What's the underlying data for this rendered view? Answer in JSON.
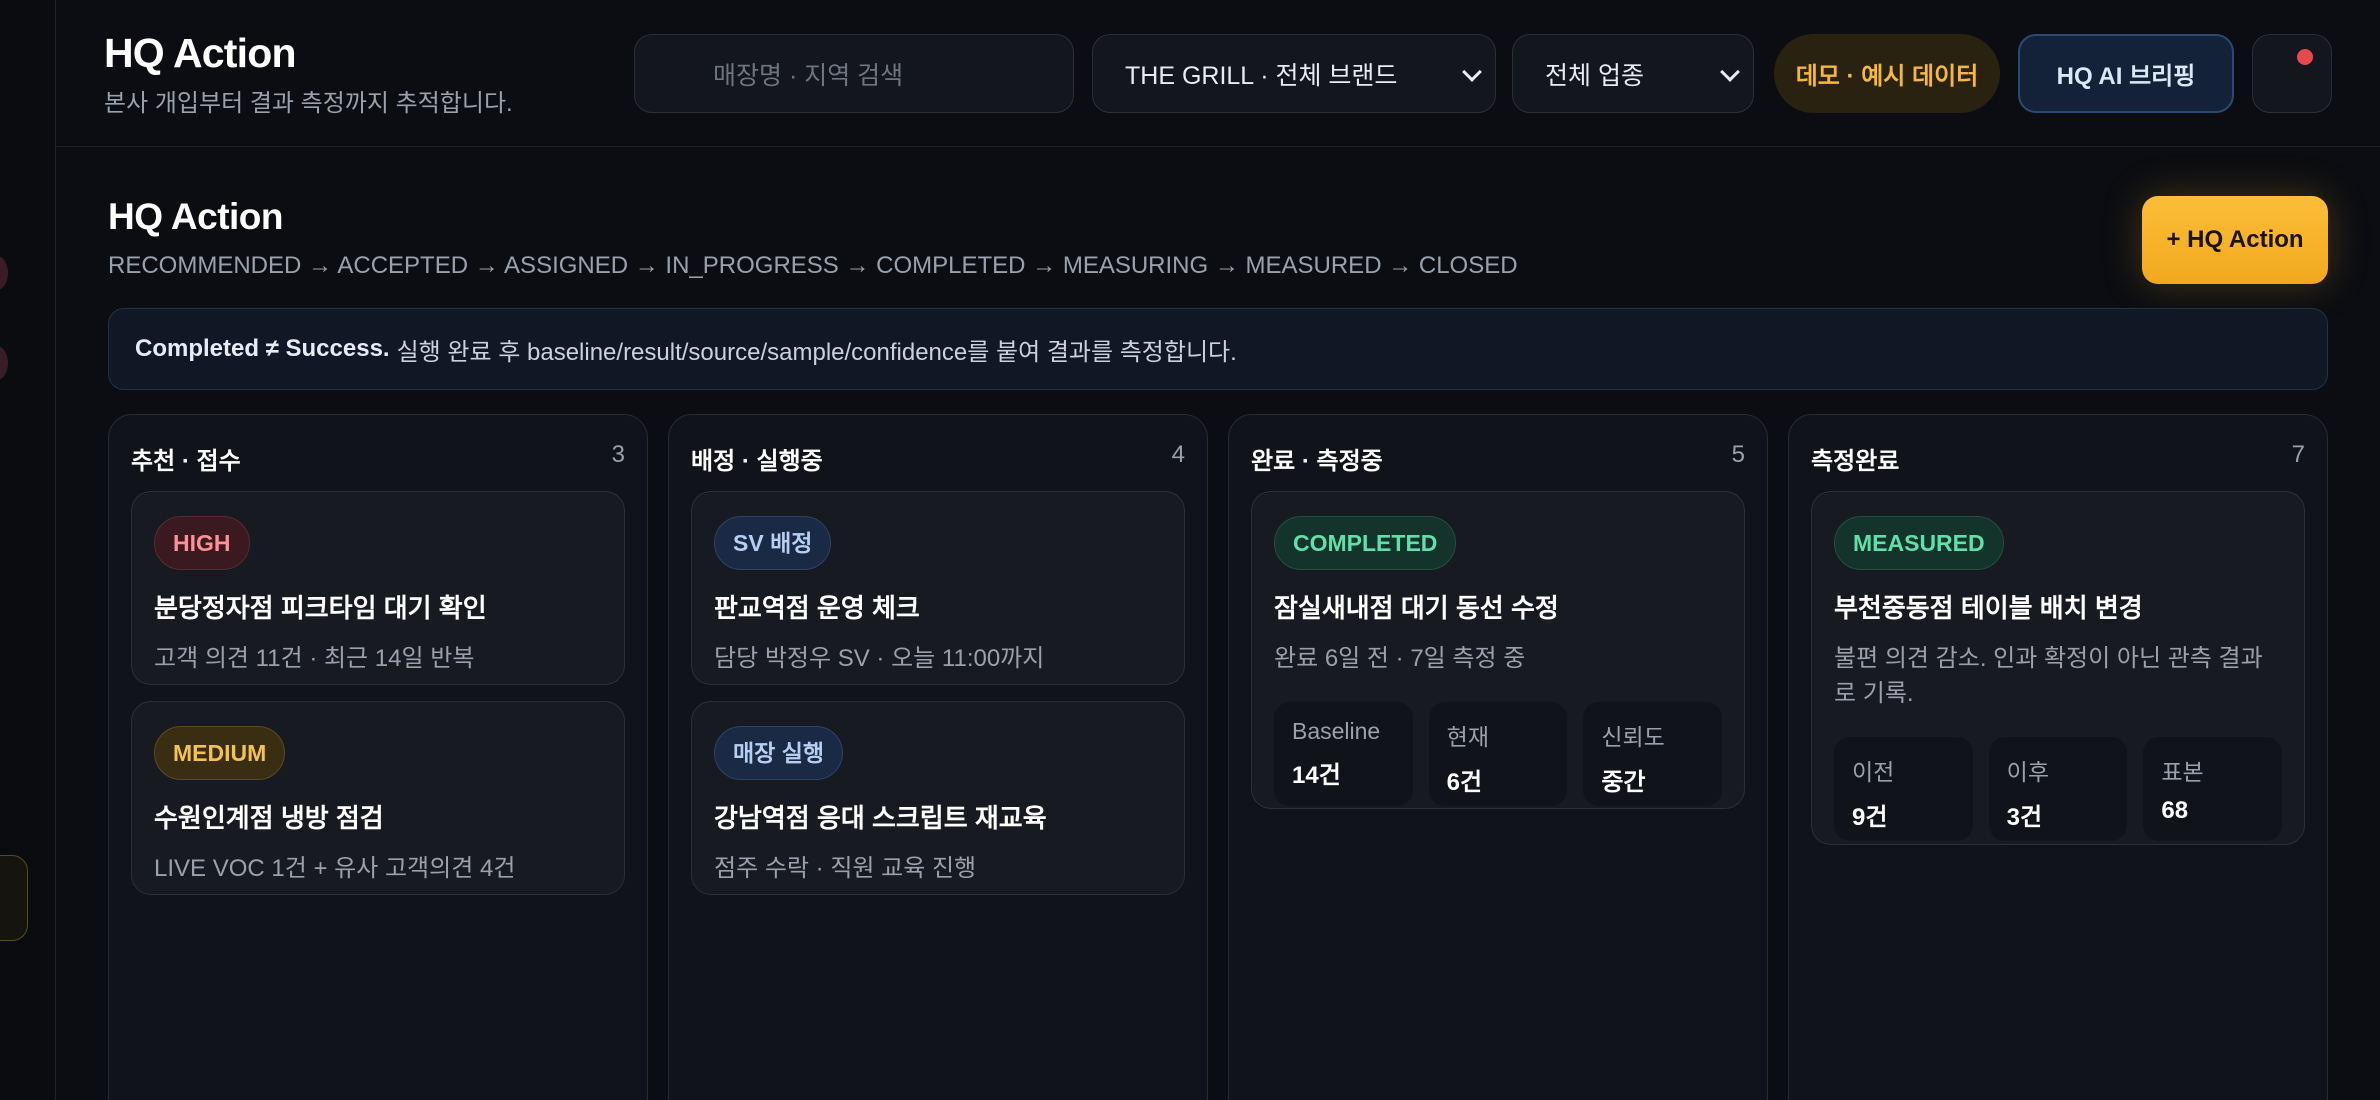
{
  "header": {
    "title": "HQ Action",
    "subtitle": "본사 개입부터 결과 측정까지 추적합니다.",
    "search_placeholder": "매장명 · 지역 검색",
    "brand_select": "THE GRILL · 전체 브랜드",
    "type_select": "전체 업종",
    "demo_badge": "데모 · 예시 데이터",
    "ai_button": "HQ AI 브리핑"
  },
  "page": {
    "title": "HQ Action",
    "flow": "RECOMMENDED → ACCEPTED → ASSIGNED → IN_PROGRESS → COMPLETED → MEASURING → MEASURED → CLOSED",
    "add_button": "+ HQ Action",
    "notice_bold": "Completed ≠ Success.",
    "notice_text": "실행 완료 후 baseline/result/source/sample/confidence를 붙여 결과를 측정합니다."
  },
  "columns": [
    {
      "title": "추천 · 접수",
      "count": "3",
      "cards": [
        {
          "badge": "HIGH",
          "title": "분당정자점 피크타임 대기 확인",
          "sub": "고객 의견 11건 · 최근 14일 반복"
        },
        {
          "badge": "MEDIUM",
          "title": "수원인계점 냉방 점검",
          "sub": "LIVE VOC 1건 + 유사 고객의견 4건"
        }
      ]
    },
    {
      "title": "배정 · 실행중",
      "count": "4",
      "cards": [
        {
          "badge": "SV 배정",
          "title": "판교역점 운영 체크",
          "sub": "담당 박정우 SV · 오늘 11:00까지"
        },
        {
          "badge": "매장 실행",
          "title": "강남역점 응대 스크립트 재교육",
          "sub": "점주 수락 · 직원 교육 진행"
        }
      ]
    },
    {
      "title": "완료 · 측정중",
      "count": "5",
      "cards": [
        {
          "badge": "COMPLETED",
          "title": "잠실새내점 대기 동선 수정",
          "sub": "완료 6일 전 · 7일 측정 중",
          "metrics": [
            {
              "label": "Baseline",
              "value": "14건"
            },
            {
              "label": "현재",
              "value": "6건"
            },
            {
              "label": "신뢰도",
              "value": "중간"
            }
          ]
        }
      ]
    },
    {
      "title": "측정완료",
      "count": "7",
      "cards": [
        {
          "badge": "MEASURED",
          "title": "부천중동점 테이블 배치 변경",
          "sub": "불편 의견 감소. 인과 확정이 아닌 관측 결과로 기록.",
          "metrics": [
            {
              "label": "이전",
              "value": "9건"
            },
            {
              "label": "이후",
              "value": "3건"
            },
            {
              "label": "표본",
              "value": "68"
            }
          ]
        }
      ]
    }
  ]
}
